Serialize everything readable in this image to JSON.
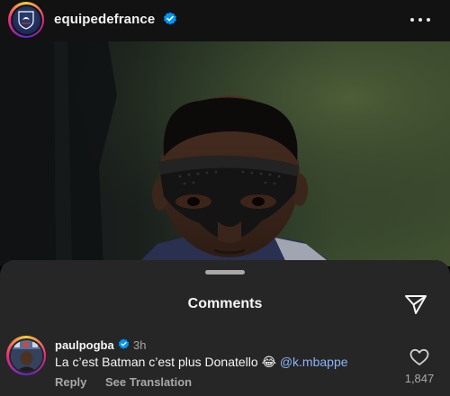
{
  "post": {
    "username": "equipedefrance",
    "verified": true,
    "image_description_icon": "photo"
  },
  "comments_sheet": {
    "title": "Comments"
  },
  "comment": {
    "username": "paulpogba",
    "verified": true,
    "time": "3h",
    "text": "La c’est Batman c’est plus Donatello",
    "emoji": "😂",
    "mention": "@k.mbappe",
    "reply_label": "Reply",
    "translation_label": "See Translation",
    "like_count": "1,847"
  },
  "colors": {
    "background": "#000000",
    "header_bg": "#121212",
    "sheet_bg": "#262626",
    "verified_blue": "#0095f6",
    "secondary_text": "#a8a8a8"
  }
}
